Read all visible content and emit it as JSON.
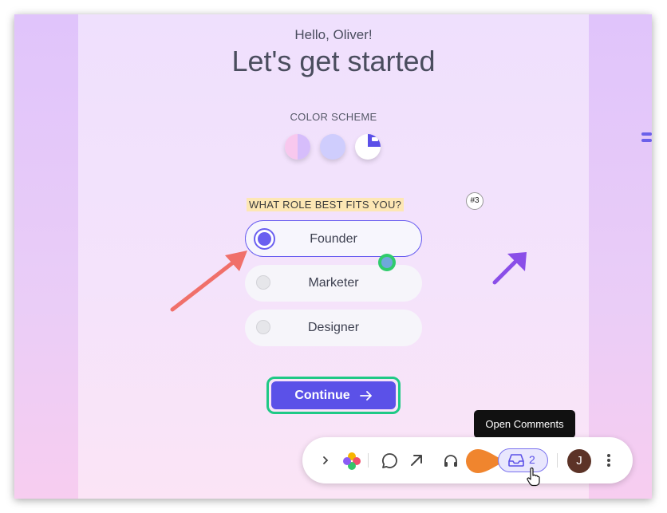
{
  "greeting": "Hello, Oliver!",
  "title": "Let's get started",
  "color_scheme": {
    "label": "COLOR SCHEME",
    "swatches": [
      "pink-lavender-split",
      "periwinkle",
      "white-with-blue-corner"
    ]
  },
  "role": {
    "question": "WHAT ROLE BEST FITS YOU?",
    "badge": "#3",
    "options": [
      {
        "label": "Founder",
        "selected": true
      },
      {
        "label": "Marketer",
        "selected": false
      },
      {
        "label": "Designer",
        "selected": false
      }
    ]
  },
  "continue": {
    "label": "Continue",
    "icon": "arrow-right-icon"
  },
  "tooltip": "Open Comments",
  "toolbar": {
    "comments_count": "2",
    "avatar_initial": "J",
    "icons": [
      "chevron-right-icon",
      "flower-logo-icon",
      "comment-icon",
      "arrow-up-right-icon",
      "headphones-icon",
      "inbox-icon",
      "more-vertical-icon"
    ]
  },
  "colors": {
    "accent": "#5b51e8",
    "highlight_border": "#1fc986",
    "annotation_red": "#f0706a",
    "annotation_purple": "#8a4ee8",
    "tooltip_bg": "#111111"
  }
}
